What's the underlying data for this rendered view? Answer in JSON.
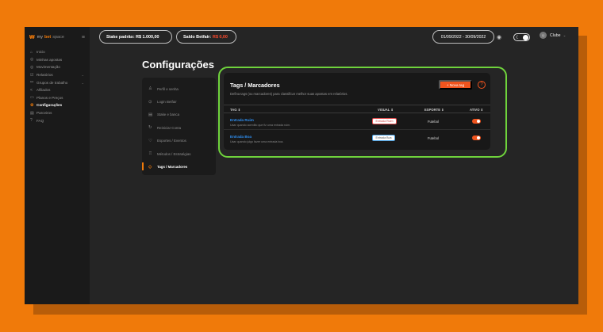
{
  "sidebar": {
    "brand": {
      "b1": "my",
      "b2": "bet",
      "b3": "space"
    },
    "items": [
      {
        "icon": "⌂",
        "label": "Inicio",
        "active": false
      },
      {
        "icon": "◎",
        "label": "Minhas apostas",
        "active": false
      },
      {
        "icon": "◎",
        "label": "Movimentação",
        "active": false
      },
      {
        "icon": "☑",
        "label": "Relatórios",
        "active": false
      },
      {
        "icon": "⚯",
        "label": "Grupos de trabalho",
        "active": false
      },
      {
        "icon": "<",
        "label": "Afiliados",
        "active": false
      },
      {
        "icon": "▭",
        "label": "Planos e Preços",
        "active": false
      },
      {
        "icon": "⚙",
        "label": "Configurações",
        "active": true
      },
      {
        "icon": "▤",
        "label": "Parceiros",
        "active": false
      },
      {
        "icon": "?",
        "label": "FAQ",
        "active": false
      }
    ]
  },
  "topbar": {
    "stake_label": "Stake padrão:",
    "stake_value": "R$ 1.000,00",
    "saldo_label": "Saldo Betfair:",
    "saldo_value": "R$ 0,00",
    "date_range": "01/09/2022 - 30/09/2022",
    "user_name": "Clube"
  },
  "page": {
    "title": "Configurações"
  },
  "settings_menu": [
    {
      "icon": "♙",
      "label": "Perfil e senha",
      "active": false
    },
    {
      "icon": "⊙",
      "label": "Login Betfair",
      "active": false
    },
    {
      "icon": "▤",
      "label": "Stake e banca",
      "active": false
    },
    {
      "icon": "↻",
      "label": "Reiniciar Conta",
      "active": false
    },
    {
      "icon": "♡",
      "label": "Esportes / Eventos",
      "active": false
    },
    {
      "icon": "♖",
      "label": "Métodos / Estratégias",
      "active": false
    },
    {
      "icon": "◇",
      "label": "Tags / Marcadores",
      "active": true
    }
  ],
  "card": {
    "title": "Tags / Marcadores",
    "description": "Defina tags (ou marcadores) para classificar melhor suas apostas em relatórios.",
    "new_button": "+ Nova tag",
    "help_icon": "?",
    "columns": {
      "tag": "TAG ⇕",
      "visual": "VISUAL ⇕",
      "esporte": "ESPORTE ⇕",
      "ativo": "ATIVO ⇕"
    },
    "rows": [
      {
        "name": "Entrada Ruim",
        "desc": "Usar quando acredito que fiz uma entrada ruim.",
        "visual": "Entrada Ruim",
        "esporte": "Futebol",
        "active": true
      },
      {
        "name": "Entrada Boa",
        "desc": "Usar quando julgo fazer uma entrada boa.",
        "visual": "Entrada Boa",
        "esporte": "Futebol",
        "active": true
      }
    ]
  },
  "colors": {
    "accent": "#f07a0a",
    "button": "#f0541e",
    "link": "#2e8ef0",
    "highlight": "#6fd33c"
  }
}
